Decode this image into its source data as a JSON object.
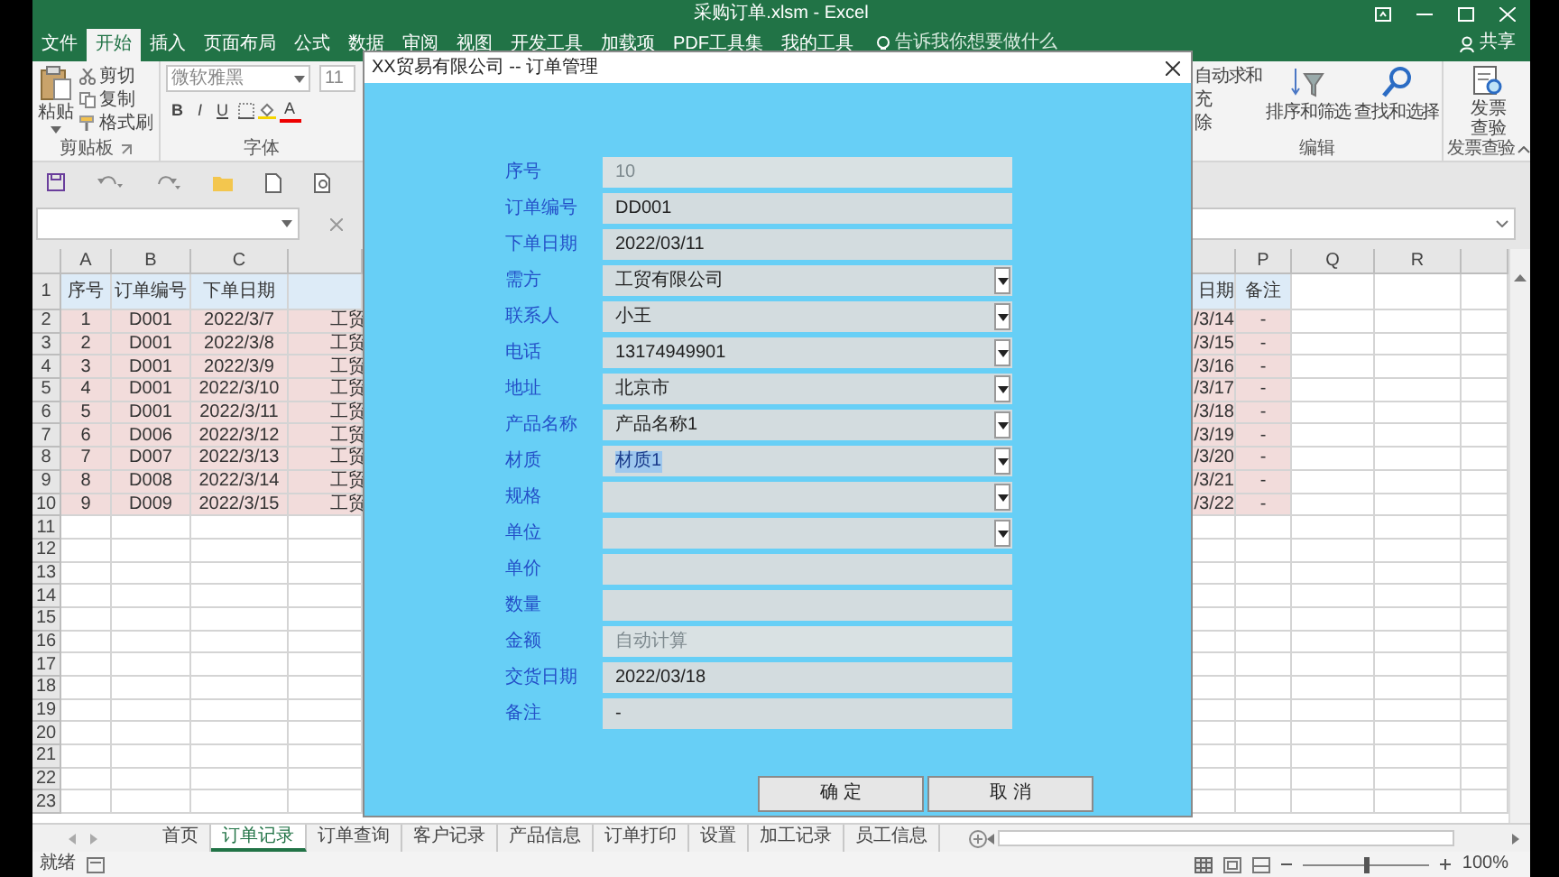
{
  "window": {
    "title": "采购订单.xlsm - Excel"
  },
  "ribbon_tabs": [
    {
      "label": "文件",
      "selected": false
    },
    {
      "label": "开始",
      "selected": true
    },
    {
      "label": "插入",
      "selected": false
    },
    {
      "label": "页面布局",
      "selected": false
    },
    {
      "label": "公式",
      "selected": false
    },
    {
      "label": "数据",
      "selected": false
    },
    {
      "label": "审阅",
      "selected": false
    },
    {
      "label": "视图",
      "selected": false
    },
    {
      "label": "开发工具",
      "selected": false
    },
    {
      "label": "加载项",
      "selected": false
    },
    {
      "label": "PDF工具集",
      "selected": false
    },
    {
      "label": "我的工具",
      "selected": false
    }
  ],
  "tell_me": {
    "placeholder": "告诉我你想要做什么"
  },
  "share_button": "共享",
  "clipboard": {
    "paste": "粘贴",
    "items": [
      "剪切",
      "复制",
      "格式刷"
    ],
    "label": "剪贴板"
  },
  "font": {
    "font_name": "微软雅黑",
    "font_size": "11",
    "styles": [
      "B",
      "I",
      "U"
    ],
    "font_color": "A",
    "label": "字体"
  },
  "editing": {
    "items": [
      "自动求和",
      "充",
      "除"
    ],
    "sort": "排序和筛选",
    "find": "查找和选择",
    "label": "编辑"
  },
  "invoice": {
    "button": "发票查验",
    "label": "发票查验"
  },
  "sheet": {
    "left_columns": [
      {
        "letter": "A",
        "header": "序号"
      },
      {
        "letter": "B",
        "header": "订单编号"
      },
      {
        "letter": "C",
        "header": "下单日期"
      }
    ],
    "right_columns": [
      {
        "header": "日期"
      },
      {
        "letter": "P",
        "header": "备注"
      },
      {
        "letter": "Q"
      },
      {
        "letter": "R"
      }
    ],
    "row_numbers": [
      "1",
      "2",
      "3",
      "4",
      "5",
      "6",
      "7",
      "8",
      "9",
      "10",
      "11",
      "12",
      "13",
      "14",
      "15",
      "16",
      "17",
      "18",
      "19",
      "20",
      "21",
      "22",
      "23"
    ],
    "rows": [
      [
        "1",
        "D001",
        "2022/3/7",
        "工贸",
        "/3/14",
        "-"
      ],
      [
        "2",
        "D001",
        "2022/3/8",
        "工贸",
        "/3/15",
        "-"
      ],
      [
        "3",
        "D001",
        "2022/3/9",
        "工贸",
        "/3/16",
        "-"
      ],
      [
        "4",
        "D001",
        "2022/3/10",
        "工贸",
        "/3/17",
        "-"
      ],
      [
        "5",
        "D001",
        "2022/3/11",
        "工贸",
        "/3/18",
        "-"
      ],
      [
        "6",
        "D006",
        "2022/3/12",
        "工贸",
        "/3/19",
        "-"
      ],
      [
        "7",
        "D007",
        "2022/3/13",
        "工贸",
        "/3/20",
        "-"
      ],
      [
        "8",
        "D008",
        "2022/3/14",
        "工贸",
        "/3/21",
        "-"
      ],
      [
        "9",
        "D009",
        "2022/3/15",
        "工贸",
        "/3/22",
        "-"
      ]
    ]
  },
  "dialog": {
    "title": "XX贸易有限公司 -- 订单管理",
    "fields": [
      {
        "label": "序号",
        "kind": "text",
        "value": "10",
        "disabled": true,
        "value_selected": false
      },
      {
        "label": "订单编号",
        "kind": "text",
        "value": "DD001",
        "disabled": false,
        "value_selected": false
      },
      {
        "label": "下单日期",
        "kind": "text",
        "value": "2022/03/11",
        "disabled": false,
        "value_selected": false
      },
      {
        "label": "需方",
        "kind": "dropdown",
        "value": "工贸有限公司",
        "disabled": false,
        "value_selected": false
      },
      {
        "label": "联系人",
        "kind": "dropdown",
        "value": "小王",
        "disabled": false,
        "value_selected": false
      },
      {
        "label": "电话",
        "kind": "dropdown",
        "value": "13174949901",
        "disabled": false,
        "value_selected": false
      },
      {
        "label": "地址",
        "kind": "dropdown",
        "value": "北京市",
        "disabled": false,
        "value_selected": false
      },
      {
        "label": "产品名称",
        "kind": "dropdown",
        "value": "产品名称1",
        "disabled": false,
        "value_selected": false
      },
      {
        "label": "材质",
        "kind": "dropdown",
        "value": "材质1",
        "disabled": false,
        "value_selected": true
      },
      {
        "label": "规格",
        "kind": "dropdown"
      },
      {
        "label": "单位",
        "kind": "dropdown"
      },
      {
        "label": "单价",
        "kind": "text"
      },
      {
        "label": "数量",
        "kind": "text"
      },
      {
        "label": "金额",
        "kind": "text",
        "value": "自动计算",
        "disabled": true,
        "value_selected": false
      },
      {
        "label": "交货日期",
        "kind": "text",
        "value": "2022/03/18",
        "disabled": false,
        "value_selected": false
      },
      {
        "label": "备注",
        "kind": "text",
        "value": "-",
        "disabled": false,
        "value_selected": false
      }
    ],
    "buttons": [
      "确 定",
      "取 消"
    ]
  },
  "sheet_tabs": [
    {
      "label": "首页",
      "selected": false
    },
    {
      "label": "订单记录",
      "selected": true
    },
    {
      "label": "订单查询",
      "selected": false
    },
    {
      "label": "客户记录",
      "selected": false
    },
    {
      "label": "产品信息",
      "selected": false
    },
    {
      "label": "订单打印",
      "selected": false
    },
    {
      "label": "设置",
      "selected": false
    },
    {
      "label": "加工记录",
      "selected": false
    },
    {
      "label": "员工信息",
      "selected": false
    }
  ],
  "status_bar": {
    "text": "就绪",
    "zoom": "100%",
    "zoom_slider": {
      "level": 0.5
    }
  }
}
